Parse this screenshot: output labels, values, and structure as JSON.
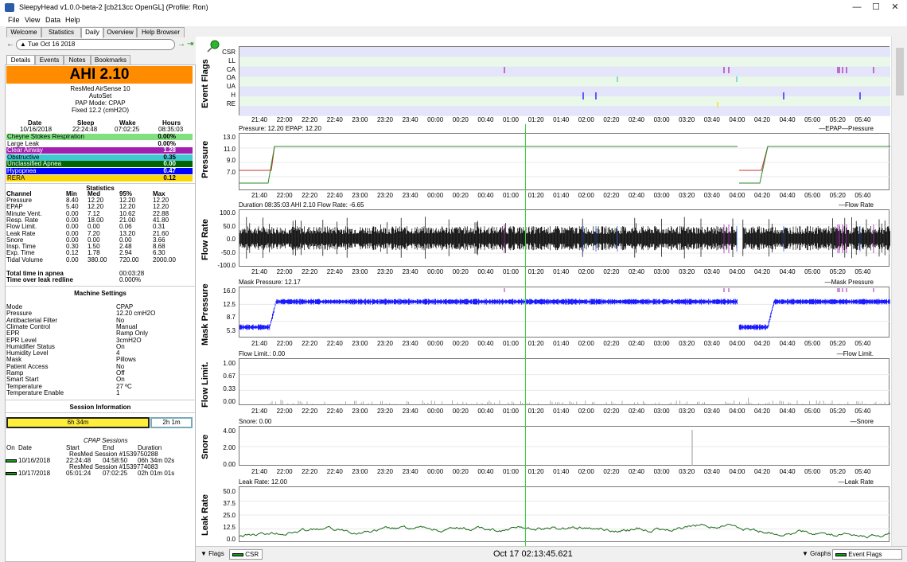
{
  "window": {
    "title": "SleepyHead v1.0.0-beta-2 [cb213cc OpenGL] (Profile: Ron)"
  },
  "menu": [
    "File",
    "View",
    "Data",
    "Help"
  ],
  "main_tabs": [
    "Welcome",
    "Statistics",
    "Daily",
    "Overview",
    "Help Browser"
  ],
  "date_nav": {
    "date": "Tue Oct 16 2018"
  },
  "sub_tabs": [
    "Details",
    "Events",
    "Notes",
    "Bookmarks"
  ],
  "summary": {
    "ahi": "AHI 2.10",
    "device": "ResMed AirSense 10",
    "mode": "AutoSet",
    "pap_mode": "PAP Mode: CPAP",
    "fixed": "Fixed 12.2 (cmH2O)",
    "date_hdr": [
      "Date",
      "Sleep",
      "Wake",
      "Hours"
    ],
    "date_vals": [
      "10/16/2018",
      "22:24:48",
      "07:02:25",
      "08:35:03"
    ]
  },
  "events": [
    {
      "label": "Cheyne Stokes Respiration",
      "value": "0.00%",
      "color": "#80e080"
    },
    {
      "label": "Large Leak",
      "value": "0.00%",
      "color": "#ffffff"
    },
    {
      "label": "Clear Airway",
      "value": "1.28",
      "color": "#a020b0"
    },
    {
      "label": "Obstructive",
      "value": "0.35",
      "color": "#40c8d0"
    },
    {
      "label": "Unclassified Apnea",
      "value": "0.00",
      "color": "#006400"
    },
    {
      "label": "Hypopnea",
      "value": "0.47",
      "color": "#0000ff"
    },
    {
      "label": "RERA",
      "value": "0.12",
      "color": "#ffd700"
    }
  ],
  "statistics": {
    "title": "Statistics",
    "headers": [
      "Channel",
      "Min",
      "Med",
      "95%",
      "Max"
    ],
    "rows": [
      [
        "Pressure",
        "8.40",
        "12.20",
        "12.20",
        "12.20"
      ],
      [
        "EPAP",
        "5.40",
        "12.20",
        "12.20",
        "12.20"
      ],
      [
        "Minute Vent.",
        "0.00",
        "7.12",
        "10.62",
        "22.88"
      ],
      [
        "Resp. Rate",
        "0.00",
        "18.00",
        "21.00",
        "41.80"
      ],
      [
        "Flow Limit.",
        "0.00",
        "0.00",
        "0.06",
        "0.31"
      ],
      [
        "Leak Rate",
        "0.00",
        "7.20",
        "13.20",
        "21.60"
      ],
      [
        "Snore",
        "0.00",
        "0.00",
        "0.00",
        "3.66"
      ],
      [
        "Insp. Time",
        "0.30",
        "1.50",
        "2.48",
        "8.68"
      ],
      [
        "Exp. Time",
        "0.12",
        "1.78",
        "2.94",
        "6.30"
      ],
      [
        "Tidal Volume",
        "0.00",
        "380.00",
        "720.00",
        "2000.00"
      ]
    ],
    "apnea_label": "Total time in apnea",
    "apnea_value": "00:03:28",
    "leak_label": "Time over leak redline",
    "leak_value": "0.000%"
  },
  "machine_settings": {
    "title": "Machine Settings",
    "rows": [
      [
        "Mode",
        "CPAP"
      ],
      [
        "Pressure",
        "12.20 cmH2O"
      ],
      [
        "Antibacterial Filter",
        "No"
      ],
      [
        "Climate Control",
        "Manual"
      ],
      [
        "EPR",
        "Ramp Only"
      ],
      [
        "EPR Level",
        "3cmH2O"
      ],
      [
        "Humidifier Status",
        "On"
      ],
      [
        "Humidity Level",
        "4"
      ],
      [
        "Mask",
        "Pillows"
      ],
      [
        "Patient Access",
        "No"
      ],
      [
        "Ramp",
        "Off"
      ],
      [
        "Smart Start",
        "On"
      ],
      [
        "Temperature",
        "27 ºC"
      ],
      [
        "Temperature Enable",
        "1"
      ]
    ]
  },
  "session_info": {
    "title": "Session Information",
    "bar1": "6h 34m",
    "bar1_fraction": 0.76,
    "bar2": "2h 1m",
    "cpap_title": "CPAP Sessions",
    "headers": [
      "On",
      "Date",
      "Start",
      "End",
      "Duration"
    ],
    "sessions": [
      {
        "name": "ResMed Session #1539750288",
        "date": "10/16/2018",
        "start": "22:24:48",
        "end": "04:58:50",
        "duration": "06h 34m 02s"
      },
      {
        "name": "ResMed Session #1539774083",
        "date": "10/17/2018",
        "start": "05:01:24",
        "end": "07:02:25",
        "duration": "02h 01m 01s"
      }
    ]
  },
  "time_ticks": [
    "21:40",
    "22:00",
    "22:20",
    "22:40",
    "23:00",
    "23:20",
    "23:40",
    "00:00",
    "00:20",
    "00:40",
    "01:00",
    "01:20",
    "01:40",
    "02:00",
    "02:20",
    "02:40",
    "03:00",
    "03:20",
    "03:40",
    "04:00",
    "04:20",
    "04:40",
    "05:00",
    "05:20",
    "05:40"
  ],
  "graphs": {
    "event_flags": {
      "label": "Event Flags",
      "flags": [
        "CSR",
        "LL",
        "CA",
        "OA",
        "UA",
        "H",
        "RE"
      ]
    },
    "pressure": {
      "label": "Pressure",
      "header": "Pressure: 12.20 EPAP: 12.20",
      "legend": "—EPAP—Pressure",
      "yticks": [
        "13.0",
        "11.0",
        "9.0",
        "7.0"
      ]
    },
    "flow_rate": {
      "label": "Flow Rate",
      "header": "Duration 08:35:03 AHI 2.10 Flow Rate: -6.65",
      "legend": "—Flow Rate",
      "yticks": [
        "100.0",
        "50.0",
        "0.0",
        "-50.0",
        "-100.0"
      ]
    },
    "mask_pressure": {
      "label": "Mask Pressure",
      "header": "Mask Pressure: 12.17",
      "legend": "—Mask Pressure",
      "yticks": [
        "16.0",
        "12.5",
        "8.7",
        "5.3"
      ]
    },
    "flow_limit": {
      "label": "Flow Limit.",
      "header": "Flow Limit.: 0.00",
      "legend": "—Flow Limit.",
      "yticks": [
        "1.00",
        "0.67",
        "0.33",
        "0.00"
      ]
    },
    "snore": {
      "label": "Snore",
      "header": "Snore: 0.00",
      "legend": "—Snore",
      "yticks": [
        "4.00",
        "2.00",
        "0.00"
      ]
    },
    "leak_rate": {
      "label": "Leak Rate",
      "header": "Leak Rate: 12.00",
      "legend": "—Leak Rate",
      "yticks": [
        "50.0",
        "37.5",
        "25.0",
        "12.5",
        "0.0"
      ]
    }
  },
  "bottom_bar": {
    "flags_label": "Flags",
    "flags_select": "CSR",
    "timestamp": "Oct 17 02:13:45.621",
    "graphs_label": "Graphs",
    "graphs_select": "Event Flags"
  }
}
